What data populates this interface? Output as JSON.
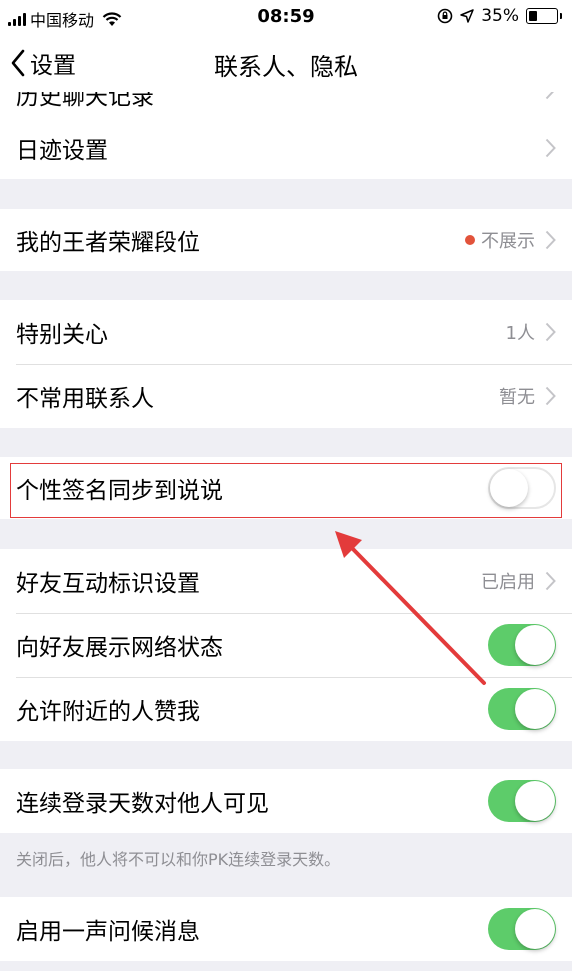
{
  "status_bar": {
    "carrier": "中国移动",
    "time": "08:59",
    "battery_percent": "35%",
    "battery_level": 0.35,
    "icons": [
      "signal-icon",
      "wifi-icon",
      "orientation-lock-icon",
      "location-icon",
      "battery-icon"
    ]
  },
  "nav": {
    "back_label": "设置",
    "title": "联系人、隐私"
  },
  "partial_row": {
    "label": "历史聊天记录"
  },
  "groups": {
    "footprint": {
      "label": "日迹设置"
    },
    "game": {
      "label": "我的王者荣耀段位",
      "value": "不展示"
    },
    "contacts": {
      "special": {
        "label": "特别关心",
        "value": "1人"
      },
      "rare": {
        "label": "不常用联系人",
        "value": "暂无"
      }
    },
    "signature": {
      "label": "个性签名同步到说说",
      "on": false
    },
    "interaction": {
      "mark": {
        "label": "好友互动标识设置",
        "value": "已启用"
      },
      "network": {
        "label": "向好友展示网络状态",
        "on": true
      },
      "nearby": {
        "label": "允许附近的人赞我",
        "on": true
      }
    },
    "login": {
      "label": "连续登录天数对他人可见",
      "on": true,
      "footnote": "关闭后，他人将不可以和你PK连续登录天数。"
    },
    "greeting": {
      "label": "启用一声问候消息",
      "on": true
    }
  },
  "colors": {
    "toggle_on": "#5dcc6a",
    "annotation": "#e33b3b",
    "badge_dot": "#e2533b",
    "secondary_text": "#8e8e93",
    "background": "#efeff4"
  }
}
